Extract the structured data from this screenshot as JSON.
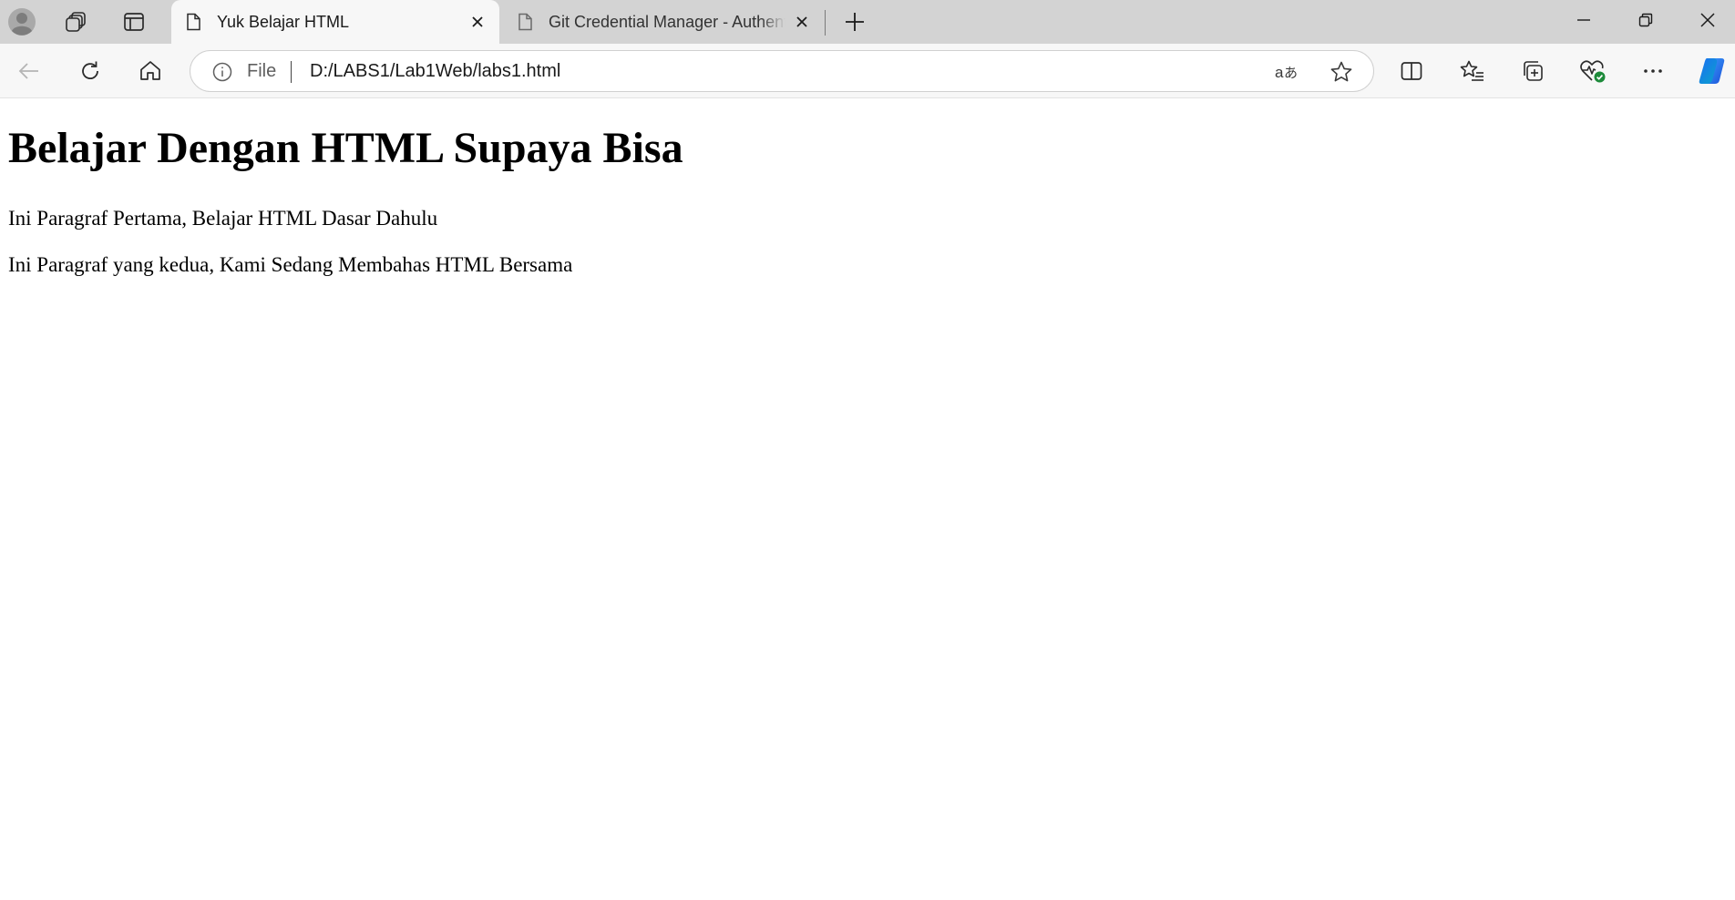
{
  "browser": {
    "tabs": [
      {
        "title": "Yuk Belajar HTML",
        "active": true
      },
      {
        "title": "Git Credential Manager - Authentication",
        "active": false
      }
    ],
    "address_bar": {
      "scheme_label": "File",
      "url": "D:/LABS1/Lab1Web/labs1.html"
    },
    "icons": {
      "profile": "profile-avatar-icon",
      "workspaces": "workspaces-icon",
      "tab_actions": "vertical-tabs-icon",
      "new_tab": "plus-icon",
      "minimize": "minimize-icon",
      "restore": "restore-icon",
      "close_window": "close-icon",
      "back": "back-arrow-icon",
      "refresh": "refresh-icon",
      "home": "home-icon",
      "site_info": "info-icon",
      "read_aloud": "translate-icon",
      "favorite": "star-icon",
      "split_screen": "split-screen-icon",
      "favorites": "favorites-list-icon",
      "collections": "collections-icon",
      "browser_essentials": "heartbeat-icon",
      "more": "more-dots-icon",
      "copilot": "copilot-icon"
    },
    "colors": {
      "tabstrip_bg": "#d3d3d3",
      "toolbar_bg": "#f7f7f7",
      "essentials_badge": "#1d8a3a",
      "copilot_blue": "#1b6ef3"
    }
  },
  "page": {
    "heading": "Belajar Dengan HTML Supaya Bisa",
    "paragraphs": [
      "Ini Paragraf Pertama, Belajar HTML Dasar Dahulu",
      "Ini Paragraf yang kedua, Kami Sedang Membahas HTML Bersama"
    ]
  }
}
